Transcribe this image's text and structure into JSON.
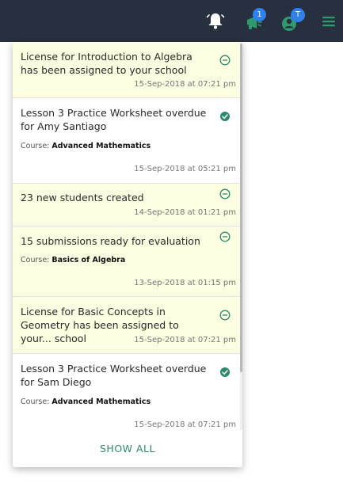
{
  "topbar": {
    "background": "#27303f",
    "icons": {
      "bell": "bell-icon",
      "megaphone": "megaphone-icon",
      "user": "user-icon",
      "menu": "hamburger-menu-icon"
    },
    "announcement_badge": "1",
    "user_badge": "T"
  },
  "notifications": {
    "items": [
      {
        "message": "License for Introduction to Algebra has been assigned to your school",
        "course_label": "",
        "course_name": "",
        "timestamp": "15-Sep-2018 at 07:21 pm",
        "status": "unread"
      },
      {
        "message": "Lesson 3 Practice Worksheet overdue for Amy Santiago",
        "course_label": "Course:",
        "course_name": "Advanced Mathematics",
        "timestamp": "15-Sep-2018 at 05:21 pm",
        "status": "read"
      },
      {
        "message": "23 new students created",
        "course_label": "",
        "course_name": "",
        "timestamp": "14-Sep-2018 at 01:21 pm",
        "status": "unread"
      },
      {
        "message": "15 submissions ready for evaluation",
        "course_label": "Course:",
        "course_name": "Basics of Algebra",
        "timestamp": "13-Sep-2018 at 01:15 pm",
        "status": "unread"
      },
      {
        "message": "License for Basic Concepts in Geometry has been assigned to your... school",
        "course_label": "",
        "course_name": "",
        "timestamp": "15-Sep-2018 at 07:21 pm",
        "status": "unread"
      },
      {
        "message": "Lesson 3 Practice Worksheet overdue for Sam Diego",
        "course_label": "Course:",
        "course_name": "Advanced Mathematics",
        "timestamp": "15-Sep-2018 at 07:21 pm",
        "status": "read"
      }
    ],
    "show_all_label": "SHOW ALL"
  },
  "colors": {
    "unread_background": "#fdfde1",
    "accent_green": "#2b8a69",
    "badge_blue": "#2f80ed"
  }
}
